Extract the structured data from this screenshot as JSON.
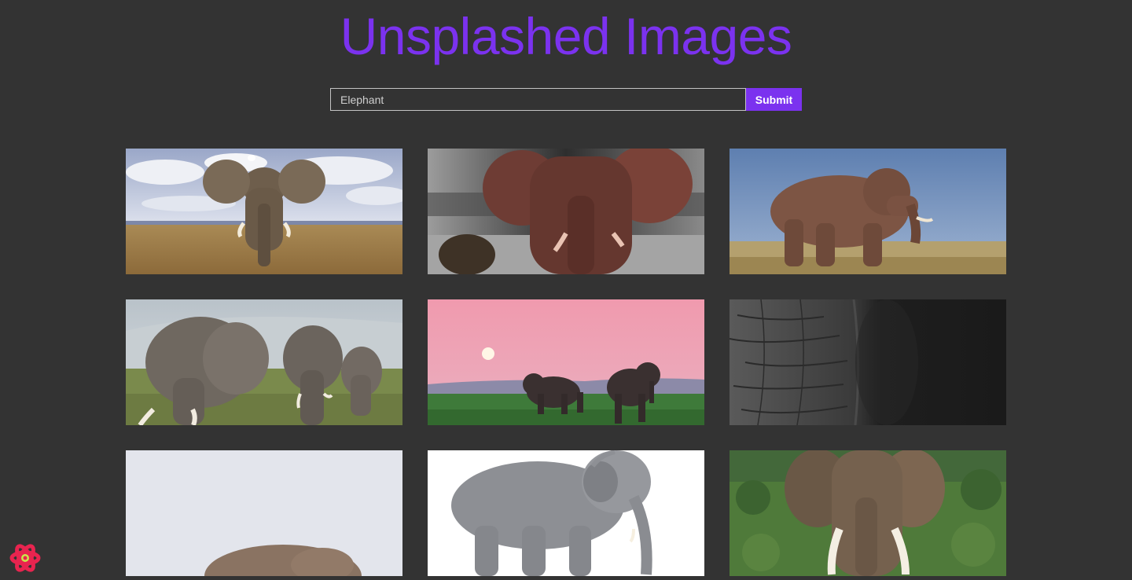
{
  "header": {
    "title": "Unsplashed Images"
  },
  "search": {
    "value": "Elephant",
    "submit_label": "Submit"
  },
  "colors": {
    "accent": "#7b32ef",
    "background": "#333333"
  },
  "gallery": {
    "images": [
      {
        "name": "elephant-savanna-cloudy-sky"
      },
      {
        "name": "elephant-red-dust-monochrome"
      },
      {
        "name": "elephant-walking-grassland"
      },
      {
        "name": "elephant-herd-three"
      },
      {
        "name": "elephants-pink-sunset"
      },
      {
        "name": "elephant-skin-closeup"
      },
      {
        "name": "elephant-lying-pale-sky"
      },
      {
        "name": "asian-elephant-white-background"
      },
      {
        "name": "elephant-tusks-bush"
      }
    ]
  },
  "corner_icon": "react-devtools-icon"
}
